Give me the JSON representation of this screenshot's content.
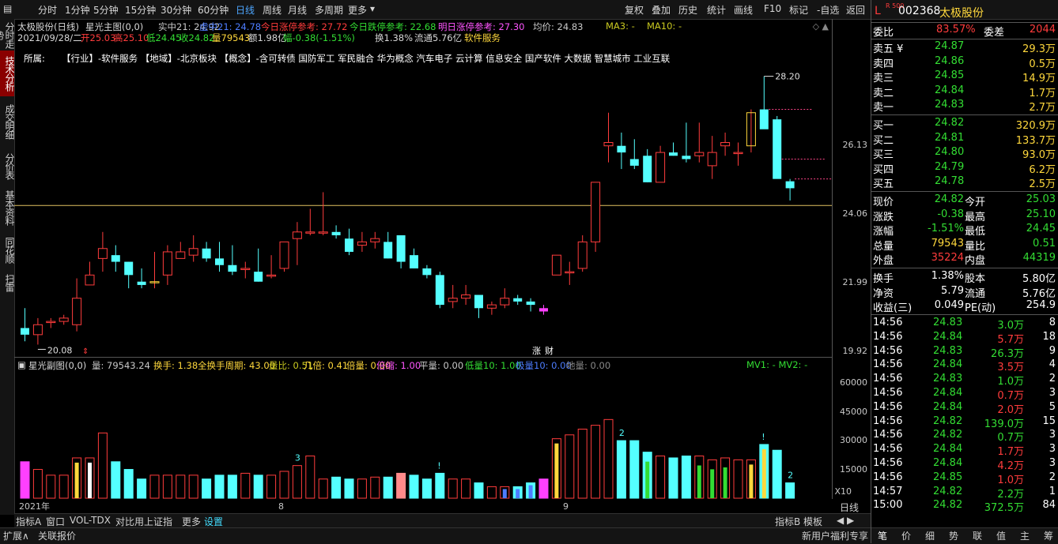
{
  "toolbar": {
    "periods": [
      "分时",
      "1分钟",
      "5分钟",
      "15分钟",
      "30分钟",
      "60分钟",
      "日线",
      "周线",
      "月线",
      "多周期",
      "更多"
    ],
    "active_period": "日线",
    "actions": [
      "复权",
      "叠加",
      "历史",
      "统计",
      "画线",
      "F10",
      "标记",
      "-自选",
      "返回"
    ]
  },
  "left_tabs": [
    "分时走势",
    "技术分析",
    "成交明细",
    "分价表",
    "基本资料",
    "同花顺",
    "扫雷"
  ],
  "main_chart": {
    "title": "太极股份(日线)",
    "indicator": "星光主图(0,0)",
    "indicator_values": [
      {
        "text": "实中21: 24.92",
        "color": "#c8c8c8"
      },
      {
        "text": "虚中21: 24.78",
        "color": "#4d7dff"
      },
      {
        "text": "今日涨停参考: 27.72",
        "color": "#ff3c3c"
      },
      {
        "text": "今日跌停参考: 22.68",
        "color": "#33dd33"
      },
      {
        "text": "明日涨停参考: 27.30",
        "color": "#ff55ff"
      },
      {
        "text": "均价: 24.83",
        "color": "#c8c8c8"
      },
      {
        "text": "MA3: -",
        "color": "#c8c820"
      },
      {
        "text": "MA10: -",
        "color": "#c8c820"
      }
    ],
    "day_info": {
      "date": "2021/09/28/二",
      "open": "开25.03",
      "high": "高25.10",
      "low": "低24.45",
      "close": "收24.82",
      "volume": "量79543",
      "amount": "额1.98亿",
      "change": "幅-0.38(-1.51%)",
      "turnover": "换1.38%",
      "float": "流通5.76亿",
      "industry": "软件服务"
    },
    "belongs_label": "所属:",
    "tags": "【行业】-软件服务 【地域】-北京板块  【概念】-含可转债 国防军工 军民融合 华为概念 汽车电子 云计算 信息安全 国产软件 大数据 智慧城市 工业互联",
    "high_label": "28.20",
    "low_label": "20.08",
    "price_axis": [
      "26.13",
      "24.06",
      "21.99",
      "19.92"
    ],
    "marker_labels": [
      "涨",
      "财"
    ]
  },
  "sub_chart": {
    "title": "星光副图(0,0)",
    "values": [
      {
        "text": "量: 79543.24",
        "color": "#c8c8c8"
      },
      {
        "text": "换手: 1.38",
        "color": "#ffd83c"
      },
      {
        "text": "全换手周期: 43.00",
        "color": "#ffd83c"
      },
      {
        "text": "量比: 0.51",
        "color": "#c8c820"
      },
      {
        "text": "几倍: 0.41",
        "color": "#ffd83c"
      },
      {
        "text": "倍量: 0.00",
        "color": "#ffd83c"
      },
      {
        "text": "倍缩: 1.00",
        "color": "#ff55ff"
      },
      {
        "text": "平量: 0.00",
        "color": "#c8c8c8"
      },
      {
        "text": "低量10: 1.00",
        "color": "#33dd33"
      },
      {
        "text": "极量10: 0.00",
        "color": "#4d7dff"
      },
      {
        "text": "地量: 0.00",
        "color": "#888888"
      }
    ],
    "mv": "MV1: -    MV2: -",
    "volume_axis": [
      "60000",
      "45000",
      "30000",
      "15000",
      "X10"
    ],
    "bar_marks": [
      "3",
      "!",
      "2",
      "!",
      "2"
    ]
  },
  "x_axis": {
    "year": "2021年",
    "months": [
      "8",
      "9"
    ]
  },
  "chart_data": {
    "type": "candlestick",
    "series_order": "daily candles oldest to newest (open, high, low, close)",
    "candles": [
      [
        20.6,
        21.2,
        20.2,
        20.4
      ],
      [
        20.4,
        20.9,
        20.1,
        20.7
      ],
      [
        20.8,
        20.9,
        20.6,
        20.8
      ],
      [
        20.8,
        21.0,
        20.7,
        20.9
      ],
      [
        20.7,
        22.1,
        20.5,
        21.5
      ],
      [
        21.9,
        22.6,
        21.9,
        22.2
      ],
      [
        22.7,
        23.5,
        22.3,
        23.0
      ],
      [
        22.8,
        23.1,
        22.3,
        22.6
      ],
      [
        22.6,
        22.6,
        21.8,
        22.2
      ],
      [
        22.0,
        22.4,
        21.8,
        21.9
      ],
      [
        22.0,
        22.9,
        21.8,
        22.0
      ],
      [
        22.2,
        23.1,
        21.9,
        22.9
      ],
      [
        22.7,
        23.2,
        22.7,
        22.9
      ],
      [
        22.8,
        23.4,
        22.6,
        23.0
      ],
      [
        23.0,
        23.2,
        22.6,
        22.7
      ],
      [
        22.7,
        23.2,
        22.3,
        22.5
      ],
      [
        22.5,
        23.1,
        22.2,
        22.3
      ],
      [
        22.4,
        22.6,
        22.1,
        22.4
      ],
      [
        22.3,
        23.0,
        22.0,
        22.0
      ],
      [
        22.2,
        22.8,
        22.1,
        22.2
      ],
      [
        22.4,
        23.2,
        22.3,
        23.2
      ],
      [
        23.3,
        23.8,
        22.5,
        23.5
      ],
      [
        23.5,
        24.2,
        23.4,
        23.5
      ],
      [
        23.5,
        24.7,
        23.4,
        23.5
      ],
      [
        23.5,
        23.7,
        23.3,
        23.4
      ],
      [
        23.3,
        23.6,
        22.8,
        22.9
      ],
      [
        23.1,
        23.5,
        22.9,
        23.2
      ],
      [
        23.2,
        23.5,
        23.0,
        23.3
      ],
      [
        23.2,
        23.5,
        22.7,
        22.7
      ],
      [
        23.4,
        23.4,
        22.4,
        22.6
      ],
      [
        22.8,
        23.0,
        22.4,
        22.4
      ],
      [
        22.4,
        22.5,
        22.1,
        22.2
      ],
      [
        22.2,
        22.3,
        21.2,
        21.3
      ],
      [
        21.4,
        21.9,
        21.2,
        21.5
      ],
      [
        21.5,
        21.9,
        21.3,
        21.6
      ],
      [
        21.6,
        21.6,
        20.9,
        21.2
      ],
      [
        21.2,
        21.4,
        21.0,
        21.3
      ],
      [
        21.3,
        21.8,
        21.2,
        21.5
      ],
      [
        21.5,
        21.6,
        21.3,
        21.4
      ],
      [
        21.4,
        21.5,
        21.1,
        21.3
      ],
      [
        21.2,
        21.3,
        21.0,
        21.1
      ],
      [
        22.2,
        22.8,
        22.2,
        22.8
      ],
      [
        22.3,
        22.6,
        21.9,
        22.3
      ],
      [
        22.4,
        23.4,
        22.3,
        23.2
      ],
      [
        23.2,
        25.0,
        22.9,
        25.0
      ],
      [
        26.1,
        27.1,
        25.6,
        26.2
      ],
      [
        26.1,
        26.5,
        25.4,
        25.9
      ],
      [
        25.7,
        26.3,
        25.4,
        25.5
      ],
      [
        25.8,
        26.0,
        25.0,
        25.0
      ],
      [
        25.0,
        26.1,
        25.0,
        25.9
      ],
      [
        25.9,
        26.2,
        25.8,
        25.8
      ],
      [
        25.8,
        26.8,
        25.6,
        25.7
      ],
      [
        25.8,
        26.8,
        25.6,
        25.9
      ],
      [
        25.5,
        26.4,
        25.1,
        25.9
      ],
      [
        26.1,
        26.5,
        25.8,
        26.2
      ],
      [
        25.9,
        26.2,
        25.5,
        25.9
      ],
      [
        26.1,
        27.2,
        25.9,
        27.1
      ],
      [
        27.2,
        28.2,
        26.7,
        26.6
      ],
      [
        26.9,
        27.0,
        25.3,
        25.1
      ],
      [
        25.03,
        25.1,
        24.45,
        24.82
      ]
    ],
    "volume": [
      19000,
      15000,
      12000,
      12000,
      21000,
      21000,
      34000,
      19000,
      15000,
      10000,
      12000,
      12000,
      12000,
      12000,
      10000,
      12000,
      12000,
      13000,
      12000,
      12000,
      14000,
      17000,
      22000,
      10000,
      11000,
      10000,
      10000,
      11000,
      11000,
      13000,
      12000,
      10000,
      13000,
      10000,
      10000,
      8000,
      6000,
      6000,
      6000,
      8000,
      10000,
      31000,
      33000,
      36000,
      38000,
      41000,
      30000,
      30000,
      24000,
      22000,
      21000,
      22000,
      22000,
      20000,
      21000,
      20000,
      20000,
      28000,
      25000,
      8000
    ],
    "y_axis_range": [
      19.92,
      28.5
    ],
    "volume_axis_range": [
      0,
      65000
    ]
  },
  "bottom_tabs": [
    "指标A",
    "窗口",
    "VOL-TDX",
    "对比用上证指",
    "更多",
    "设置"
  ],
  "bottom_right": [
    "指标B",
    "模板"
  ],
  "period_label_bottom": "日线",
  "status_left": [
    "扩展∧",
    "关联报价"
  ],
  "status_right": {
    "notice": "新用户福利专享",
    "tabs": [
      "笔",
      "价",
      "细",
      "势",
      "联",
      "值",
      "主",
      "筹"
    ]
  },
  "panel": {
    "prefix": "L",
    "small_tag": "R 500",
    "code": "002368",
    "name": "太极股份",
    "weibi_label": "委比",
    "weibi_value": "83.57%",
    "weicha_label": "委差",
    "weicha_value": "2044",
    "asks": [
      {
        "label": "卖五 ¥",
        "price": "24.87",
        "vol": "29.3万"
      },
      {
        "label": "卖四",
        "price": "24.86",
        "vol": "0.5万"
      },
      {
        "label": "卖三",
        "price": "24.85",
        "vol": "14.9万"
      },
      {
        "label": "卖二",
        "price": "24.84",
        "vol": "1.7万"
      },
      {
        "label": "卖一",
        "price": "24.83",
        "vol": "2.7万"
      }
    ],
    "bids": [
      {
        "label": "买一",
        "price": "24.82",
        "vol": "320.9万"
      },
      {
        "label": "买二",
        "price": "24.81",
        "vol": "133.7万"
      },
      {
        "label": "买三",
        "price": "24.80",
        "vol": "93.0万"
      },
      {
        "label": "买四",
        "price": "24.79",
        "vol": "6.2万"
      },
      {
        "label": "买五",
        "price": "24.78",
        "vol": "2.5万"
      }
    ],
    "quote": [
      {
        "l1": "现价",
        "v1": "24.82",
        "c1": "green",
        "l2": "今开",
        "v2": "25.03",
        "c2": "green"
      },
      {
        "l1": "涨跌",
        "v1": "-0.38",
        "c1": "green",
        "l2": "最高",
        "v2": "25.10",
        "c2": "green"
      },
      {
        "l1": "涨幅",
        "v1": "-1.51%",
        "c1": "green",
        "l2": "最低",
        "v2": "24.45",
        "c2": "green"
      },
      {
        "l1": "总量",
        "v1": "79543",
        "c1": "yellow",
        "l2": "量比",
        "v2": "0.51",
        "c2": "green"
      },
      {
        "l1": "外盘",
        "v1": "35224",
        "c1": "red",
        "l2": "内盘",
        "v2": "44319",
        "c2": "green"
      }
    ],
    "fundamentals": [
      {
        "l1": "换手",
        "v1": "1.38%",
        "l2": "股本",
        "v2": "5.80亿"
      },
      {
        "l1": "净资",
        "v1": "5.79",
        "l2": "流通",
        "v2": "5.76亿"
      },
      {
        "l1": "收益(三)",
        "v1": "0.049",
        "l2": "PE(动)",
        "v2": "254.9"
      }
    ],
    "ticks": [
      {
        "time": "14:56",
        "price": "24.83",
        "vol": "3.0万",
        "vc": "green",
        "n": "8"
      },
      {
        "time": "14:56",
        "price": "24.84",
        "vol": "5.7万",
        "vc": "red",
        "n": "18"
      },
      {
        "time": "14:56",
        "price": "24.83",
        "vol": "26.3万",
        "vc": "green",
        "n": "9"
      },
      {
        "time": "14:56",
        "price": "24.84",
        "vol": "3.5万",
        "vc": "red",
        "n": "4"
      },
      {
        "time": "14:56",
        "price": "24.83",
        "vol": "1.0万",
        "vc": "green",
        "n": "2"
      },
      {
        "time": "14:56",
        "price": "24.84",
        "vol": "0.7万",
        "vc": "red",
        "n": "3"
      },
      {
        "time": "14:56",
        "price": "24.84",
        "vol": "2.0万",
        "vc": "red",
        "n": "5"
      },
      {
        "time": "14:56",
        "price": "24.82",
        "vol": "139.0万",
        "vc": "green",
        "n": "15"
      },
      {
        "time": "14:56",
        "price": "24.82",
        "vol": "0.7万",
        "vc": "green",
        "n": "3"
      },
      {
        "time": "14:56",
        "price": "24.84",
        "vol": "1.7万",
        "vc": "red",
        "n": "3"
      },
      {
        "time": "14:56",
        "price": "24.84",
        "vol": "4.2万",
        "vc": "red",
        "n": "3"
      },
      {
        "time": "14:56",
        "price": "24.85",
        "vol": "1.0万",
        "vc": "red",
        "n": "2"
      },
      {
        "time": "14:57",
        "price": "24.82",
        "vol": "2.2万",
        "vc": "green",
        "n": "1"
      },
      {
        "time": "15:00",
        "price": "24.82",
        "vol": "372.5万",
        "vc": "green",
        "n": "84"
      }
    ]
  }
}
